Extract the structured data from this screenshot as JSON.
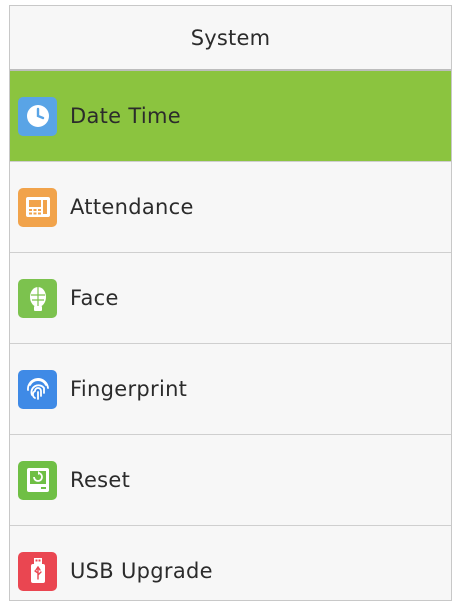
{
  "header": {
    "title": "System"
  },
  "menu": {
    "items": [
      {
        "label": "Date Time",
        "icon": "clock-icon",
        "color": "#59a4e6",
        "selected": true
      },
      {
        "label": "Attendance",
        "icon": "attendance-terminal-icon",
        "color": "#f1a34b",
        "selected": false
      },
      {
        "label": "Face",
        "icon": "face-icon",
        "color": "#7cc24e",
        "selected": false
      },
      {
        "label": "Fingerprint",
        "icon": "fingerprint-icon",
        "color": "#3f8ae6",
        "selected": false
      },
      {
        "label": "Reset",
        "icon": "reset-icon",
        "color": "#6fbf45",
        "selected": false
      },
      {
        "label": "USB Upgrade",
        "icon": "usb-icon",
        "color": "#ea4651",
        "selected": false
      }
    ]
  },
  "colors": {
    "selected_background": "#8bc43f",
    "background": "#f7f7f7"
  }
}
